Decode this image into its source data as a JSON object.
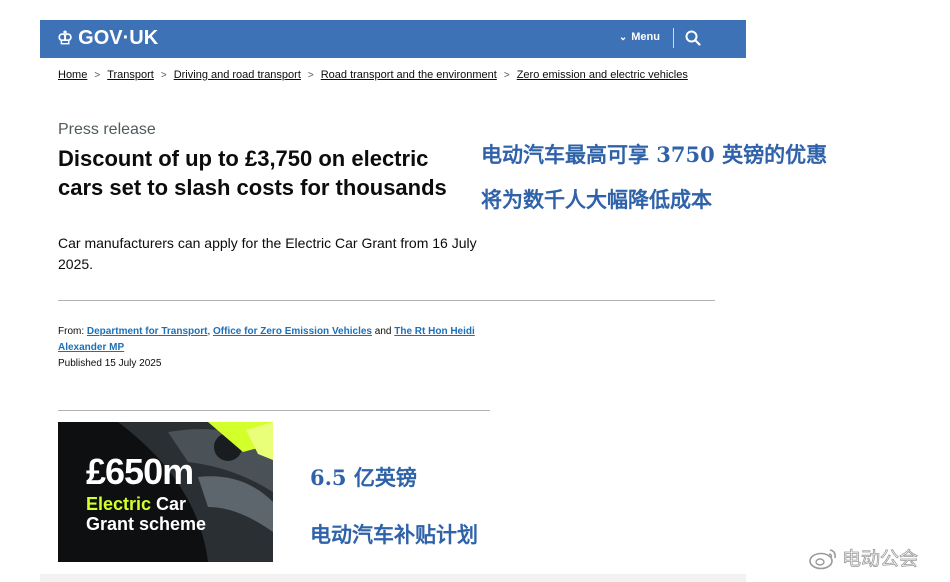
{
  "header": {
    "logo_text": "GOV·UK",
    "logo_icon": "crown-icon",
    "menu_label": "Menu",
    "menu_icon": "chevron-down-icon",
    "search_icon": "search-icon",
    "background_color": "#3d72b7"
  },
  "breadcrumbs": [
    {
      "label": "Home"
    },
    {
      "label": "Transport"
    },
    {
      "label": "Driving and road transport"
    },
    {
      "label": "Road transport and the environment"
    },
    {
      "label": "Zero emission and electric vehicles"
    }
  ],
  "article": {
    "kicker": "Press release",
    "title": "Discount of up to £3,750 on electric cars set to slash costs for thousands",
    "lead": "Car manufacturers can apply for the Electric Car Grant from 16 July 2025.",
    "from_label": "From:",
    "from_links": [
      "Department for Transport",
      "Office for Zero Emission Vehicles",
      "The Rt Hon Heidi Alexander MP"
    ],
    "from_sep1": ", ",
    "from_and": " and ",
    "published": "Published 15 July 2025"
  },
  "hero_image": {
    "amount": "£650m",
    "word_electric": "Electric",
    "word_car": " Car",
    "line3": "Grant scheme",
    "accent_color": "#d3ff2a"
  },
  "annotations": {
    "title_zh_line1": "电动汽车最高可享 3750 英镑的优惠",
    "title_zh_line2": "将为数千人大幅降低成本",
    "amount_zh": "6.5 亿英镑",
    "scheme_zh": "电动汽车补贴计划",
    "color": "#2f62a8"
  },
  "watermark": {
    "text": "电动公会",
    "icon": "weibo-icon"
  }
}
